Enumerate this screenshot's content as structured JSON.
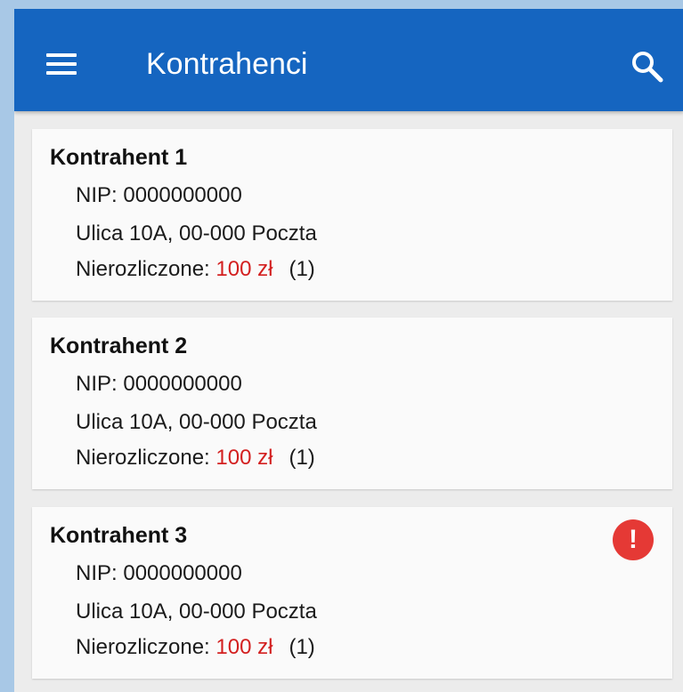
{
  "app": {
    "title": "Kontrahenci",
    "menu_icon": "hamburger-menu-icon",
    "search_icon": "search-icon"
  },
  "colors": {
    "appbar": "#1565c0",
    "amount": "#d32020",
    "alert": "#e53935",
    "background": "#ececec",
    "card": "#fafafa"
  },
  "contractors": [
    {
      "name": "Kontrahent 1",
      "nip": "NIP: 0000000000",
      "address": "Ulica 10A, 00-000 Poczta",
      "unsettled_label": "Nierozliczone: ",
      "amount": "100 zł",
      "count": "(1)",
      "alert": false
    },
    {
      "name": "Kontrahent 2",
      "nip": "NIP: 0000000000",
      "address": "Ulica 10A, 00-000 Poczta",
      "unsettled_label": "Nierozliczone: ",
      "amount": "100 zł",
      "count": "(1)",
      "alert": false
    },
    {
      "name": "Kontrahent 3",
      "nip": "NIP: 0000000000",
      "address": "Ulica 10A, 00-000 Poczta",
      "unsettled_label": "Nierozliczone: ",
      "amount": "100 zł",
      "count": "(1)",
      "alert": true,
      "alert_symbol": "!",
      "alert_icon": "alert-circle-icon"
    }
  ]
}
